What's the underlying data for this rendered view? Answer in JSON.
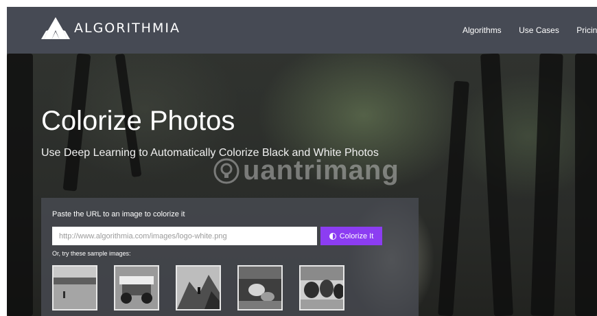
{
  "brand": {
    "name": "ALGORITHMIA"
  },
  "nav": {
    "items": [
      "Algorithms",
      "Use Cases",
      "Pricing"
    ]
  },
  "hero": {
    "title": "Colorize Photos",
    "subtitle": "Use Deep Learning to Automatically Colorize Black and White Photos"
  },
  "watermark": {
    "text": "uantrimang"
  },
  "form": {
    "label": "Paste the URL to an image to colorize it",
    "url_placeholder": "http://www.algorithmia.com/images/logo-white.png",
    "submit_label": "Colorize It",
    "submit_icon": "half-circle-icon",
    "samples_label": "Or, try these sample images:"
  },
  "samples": [
    "beach",
    "race-car",
    "mountain-climber",
    "child-with-cat",
    "cattle"
  ],
  "colors": {
    "navbar": "#464a54",
    "accent": "#8c3df2",
    "panel": "#484a52"
  }
}
